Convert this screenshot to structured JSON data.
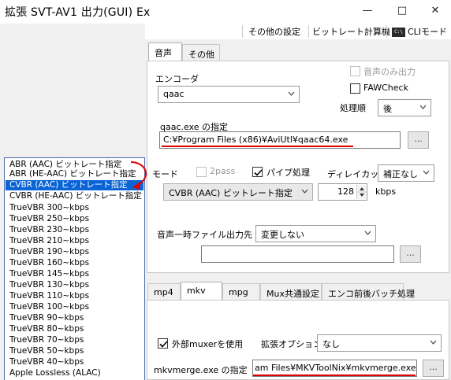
{
  "window": {
    "title": "拡張 SVT-AV1 出力(GUI) Ex",
    "minimize": "—",
    "maximize": "□",
    "close": "✕"
  },
  "toolbar": {
    "other_settings": "その他の設定",
    "bitrate_calc": "ビットレート計算機",
    "cli_mode": "CLIモード",
    "cli_icon_text": "C:\\"
  },
  "audio_tabs": [
    "音声",
    "その他"
  ],
  "audio": {
    "encoder_label": "エンコーダ",
    "encoder_value": "qaac",
    "audio_only_label": "音声のみ出力",
    "fawcheck_label": "FAWCheck",
    "order_label": "処理順",
    "order_value": "後",
    "exe_label": "qaac.exe の指定",
    "exe_path": "C:¥Program Files (x86)¥AviUtl¥qaac64.exe",
    "browse": "...",
    "mode_label": "モード",
    "twopass_label": "2pass",
    "pipe_label": "パイプ処理",
    "delay_label": "ディレイカット",
    "delay_value": "補正なし",
    "mode_value": "CVBR (AAC) ビットレート指定",
    "bitrate_value": "128",
    "bitrate_unit": "kbps",
    "temp_label": "音声一時ファイル出力先",
    "temp_value": "変更しない",
    "temp_path": "",
    "temp_browse": "..."
  },
  "mux_tabs": [
    "mp4",
    "mkv",
    "mpg",
    "Mux共通設定",
    "エンコ前後バッチ処理"
  ],
  "mux": {
    "external_muxer_label": "外部muxerを使用",
    "ext_option_label": "拡張オプション",
    "ext_option_value": "なし",
    "exe_label": "mkvmerge.exe の指定",
    "exe_path": "am Files¥MKVToolNix¥mkvmerge.exe",
    "browse": "..."
  },
  "mode_list": {
    "items": [
      "ABR (AAC) ビットレート指定",
      "ABR (HE-AAC) ビットレート指定",
      "CVBR (AAC) ビットレート指定",
      "CVBR (HE-AAC) ビットレート指定",
      "TrueVBR 300~kbps",
      "TrueVBR 250~kbps",
      "TrueVBR 230~kbps",
      "TrueVBR 210~kbps",
      "TrueVBR 190~kbps",
      "TrueVBR 160~kbps",
      "TrueVBR 145~kbps",
      "TrueVBR 130~kbps",
      "TrueVBR 110~kbps",
      "TrueVBR 100~kbps",
      "TrueVBR 90~kbps",
      "TrueVBR 80~kbps",
      "TrueVBR 70~kbps",
      "TrueVBR 50~kbps",
      "TrueVBR 40~kbps",
      "Apple Lossless (ALAC)"
    ],
    "selected_index": 2
  },
  "colors": {
    "accent_red": "#e00000",
    "selection_blue": "#0a64d6"
  }
}
